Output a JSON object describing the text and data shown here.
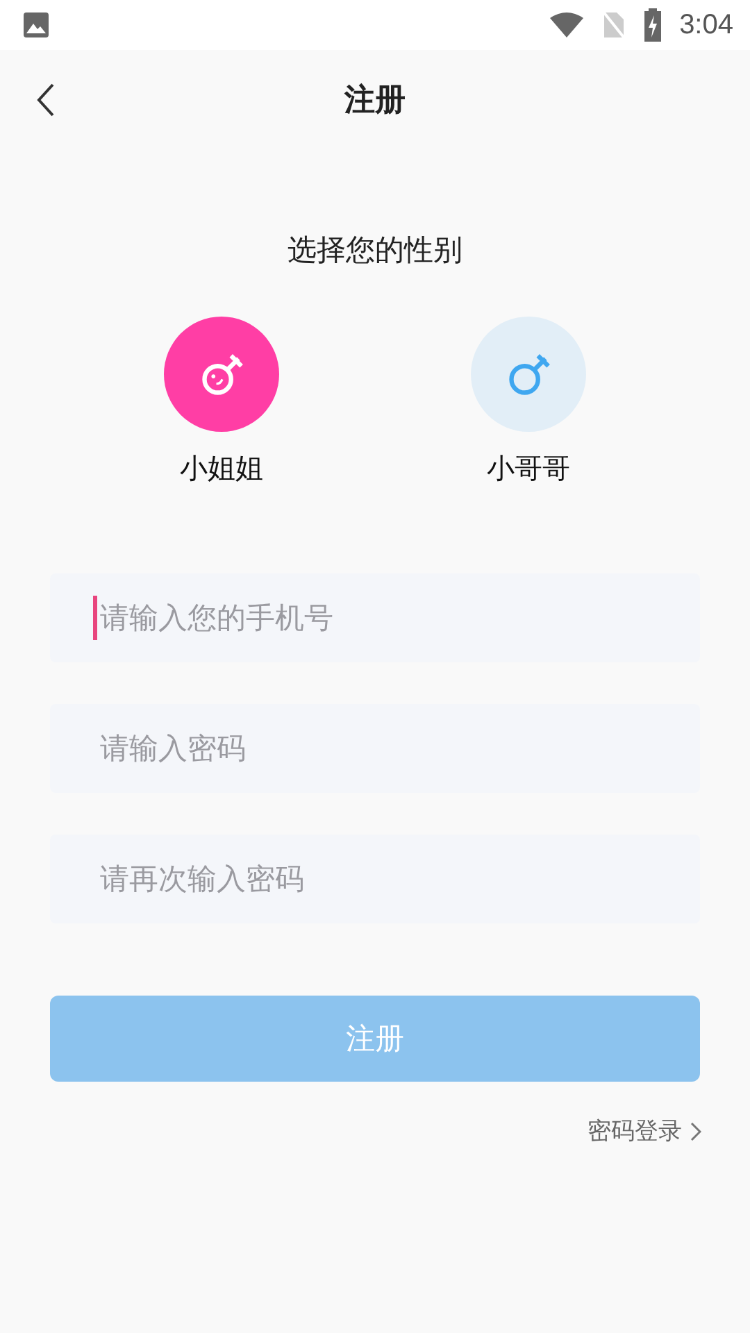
{
  "status_bar": {
    "time": "3:04"
  },
  "header": {
    "title": "注册"
  },
  "gender": {
    "heading": "选择您的性别",
    "options": [
      {
        "kind": "female",
        "label": "小姐姐",
        "selected": true,
        "color": "#ff3ea5"
      },
      {
        "kind": "male",
        "label": "小哥哥",
        "selected": false,
        "color": "#3fa7f0"
      }
    ]
  },
  "fields": [
    {
      "placeholder": "请输入您的手机号",
      "focused": true
    },
    {
      "placeholder": "请输入密码",
      "focused": false
    },
    {
      "placeholder": "请再次输入密码",
      "focused": false
    }
  ],
  "submit": {
    "label": "注册",
    "disabled": true
  },
  "login_link": {
    "label": "密码登录"
  }
}
